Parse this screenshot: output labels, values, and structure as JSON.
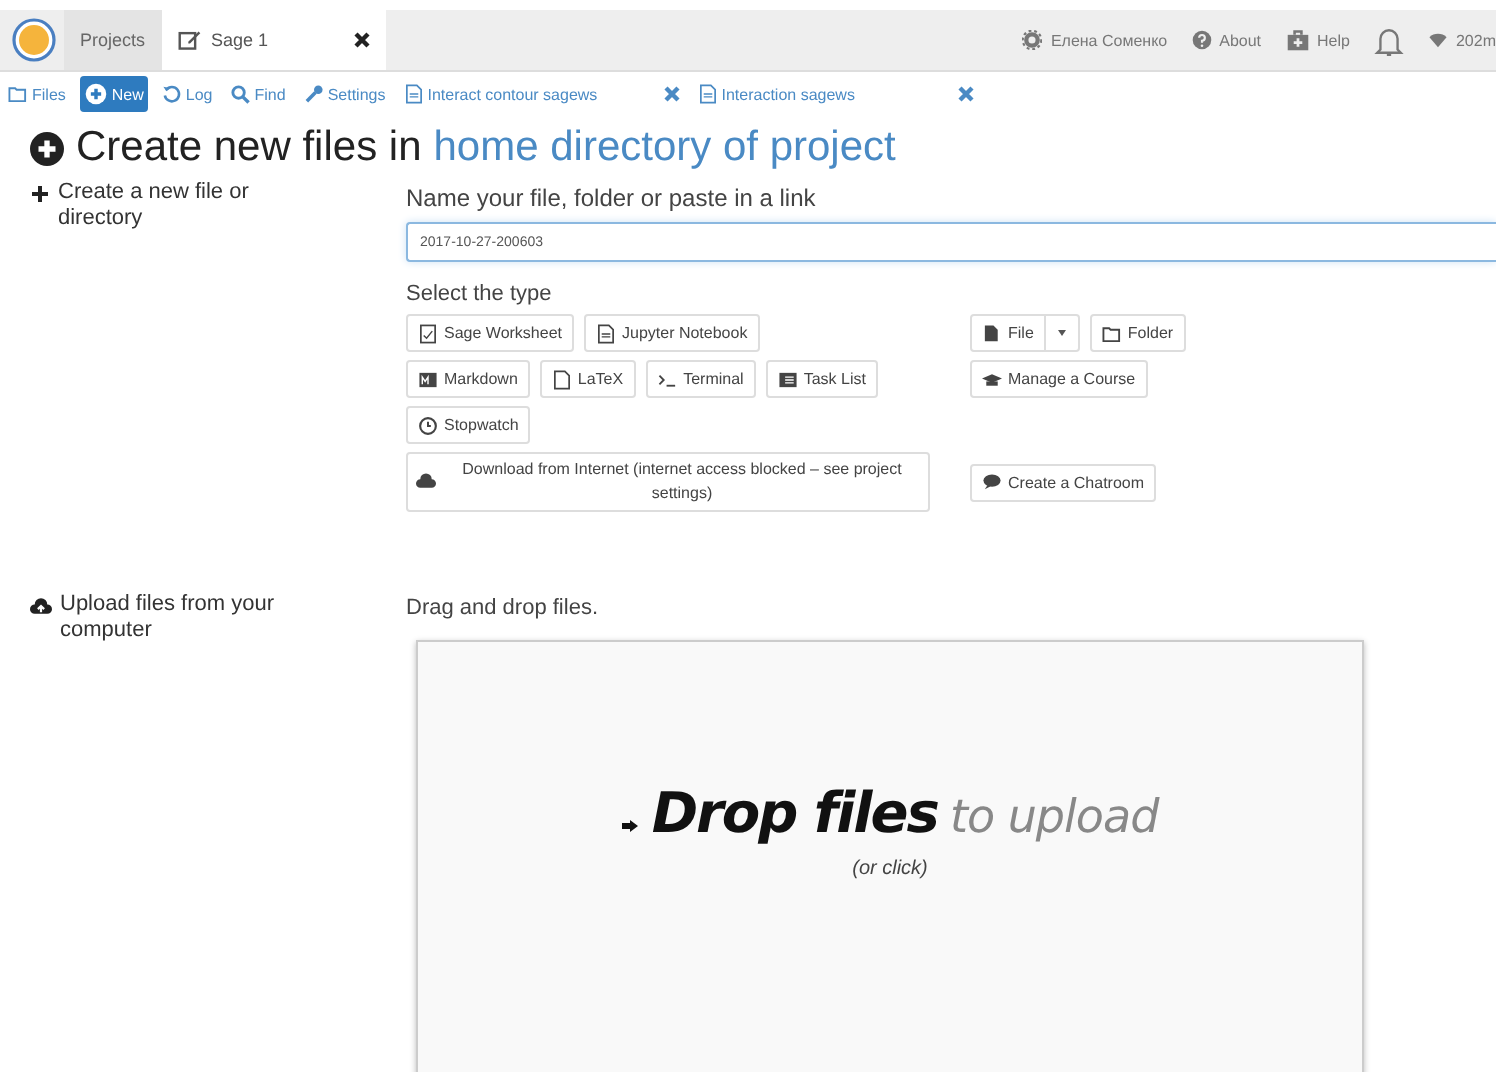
{
  "top_bar": {
    "tabs": [
      {
        "label": "Projects",
        "selected": false,
        "kind": "projects",
        "closable": false
      },
      {
        "label": "Sage 1",
        "selected": true,
        "kind": "file",
        "closable": true
      }
    ],
    "right_items": [
      {
        "kind": "account",
        "label": "Елена Соменко"
      },
      {
        "kind": "about",
        "label": "About"
      },
      {
        "kind": "help",
        "label": "Help"
      },
      {
        "kind": "notifications"
      },
      {
        "kind": "connection",
        "label": "202m"
      }
    ]
  },
  "file_tabs": [
    {
      "kind": "files",
      "label": "Files",
      "selected": false,
      "closable": false
    },
    {
      "kind": "new",
      "label": "New",
      "selected": true,
      "closable": false
    },
    {
      "kind": "log",
      "label": "Log",
      "selected": false,
      "closable": false
    },
    {
      "kind": "find",
      "label": "Find",
      "selected": false,
      "closable": false
    },
    {
      "kind": "settings",
      "label": "Settings",
      "selected": false,
      "closable": false
    },
    {
      "kind": "document",
      "label": "Interact contour sagews",
      "selected": false,
      "closable": true
    },
    {
      "kind": "document",
      "label": "Interaction sagews",
      "selected": false,
      "closable": true
    }
  ],
  "heading": {
    "prefix": "Create new files in",
    "link": "home directory of project"
  },
  "create": {
    "label": "Create a new file or directory",
    "field_label": "Name your file, folder or paste in a link",
    "filename": "2017-10-27-200603",
    "type_label": "Select the type",
    "left_rows": [
      [
        {
          "kind": "worksheet",
          "label": "Sage Worksheet"
        },
        {
          "kind": "notebook",
          "label": "Jupyter Notebook"
        }
      ],
      [
        {
          "kind": "markdown",
          "label": "Markdown"
        },
        {
          "kind": "latex",
          "label": "LaTeX"
        },
        {
          "kind": "terminal",
          "label": "Terminal"
        },
        {
          "kind": "tasks",
          "label": "Task List"
        }
      ],
      [
        {
          "kind": "stopwatch",
          "label": "Stopwatch"
        }
      ],
      [
        {
          "kind": "download",
          "label": "Download from Internet (internet access blocked – see project settings)"
        }
      ]
    ],
    "right_rows": [
      [
        {
          "kind": "file",
          "label": "File",
          "split": true
        },
        {
          "kind": "folder",
          "label": "Folder"
        }
      ],
      [
        {
          "kind": "course",
          "label": "Manage a Course"
        }
      ],
      [],
      [
        {
          "kind": "chat",
          "label": "Create a Chatroom"
        }
      ]
    ]
  },
  "upload": {
    "label": "Upload files from your computer",
    "hint": "Drag and drop files.",
    "drop_strong": "Drop files",
    "drop_rest": "to upload",
    "drop_sub": "(or click)"
  }
}
